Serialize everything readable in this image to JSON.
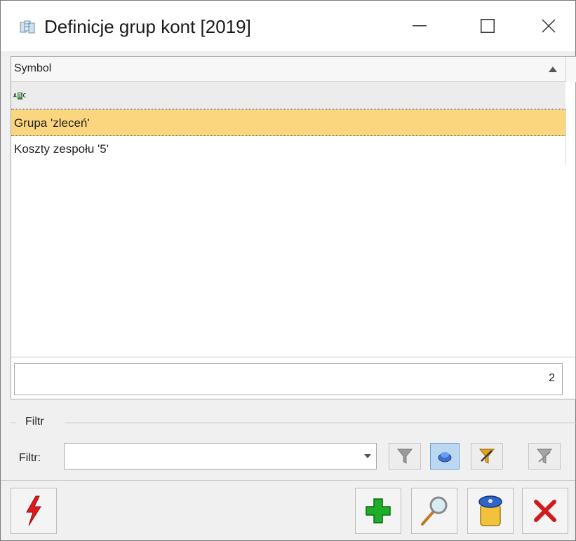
{
  "window": {
    "title": "Definicje grup kont [2019]",
    "icons": {
      "app": "tables-icon",
      "minimize": "minimize-icon",
      "maximize": "maximize-icon",
      "close": "close-icon"
    }
  },
  "grid": {
    "column_header": "Symbol",
    "sort_icon": "sort-ascending-icon",
    "filter_row_icon": "abc-filter-icon",
    "filter_row_icon_letters": [
      "A",
      "B",
      "C"
    ],
    "rows": [
      {
        "symbol": "Grupa 'zleceń'",
        "selected": true
      },
      {
        "symbol": "Koszty zespołu '5'",
        "selected": false
      }
    ],
    "count": "2"
  },
  "filter": {
    "group_label": "Filtr",
    "label": "Filtr:",
    "value": "",
    "buttons": [
      "filter-icon",
      "clear-filter-icon",
      "advanced-filter-icon",
      "filter-off-icon"
    ]
  },
  "actions": {
    "left": "quick-action-icon",
    "right": [
      "add-icon",
      "view-icon",
      "delete-icon",
      "close-icon"
    ]
  },
  "colors": {
    "selected_row": "#fbd67e",
    "add_green": "#1fae2a",
    "close_red": "#d01c1c"
  }
}
